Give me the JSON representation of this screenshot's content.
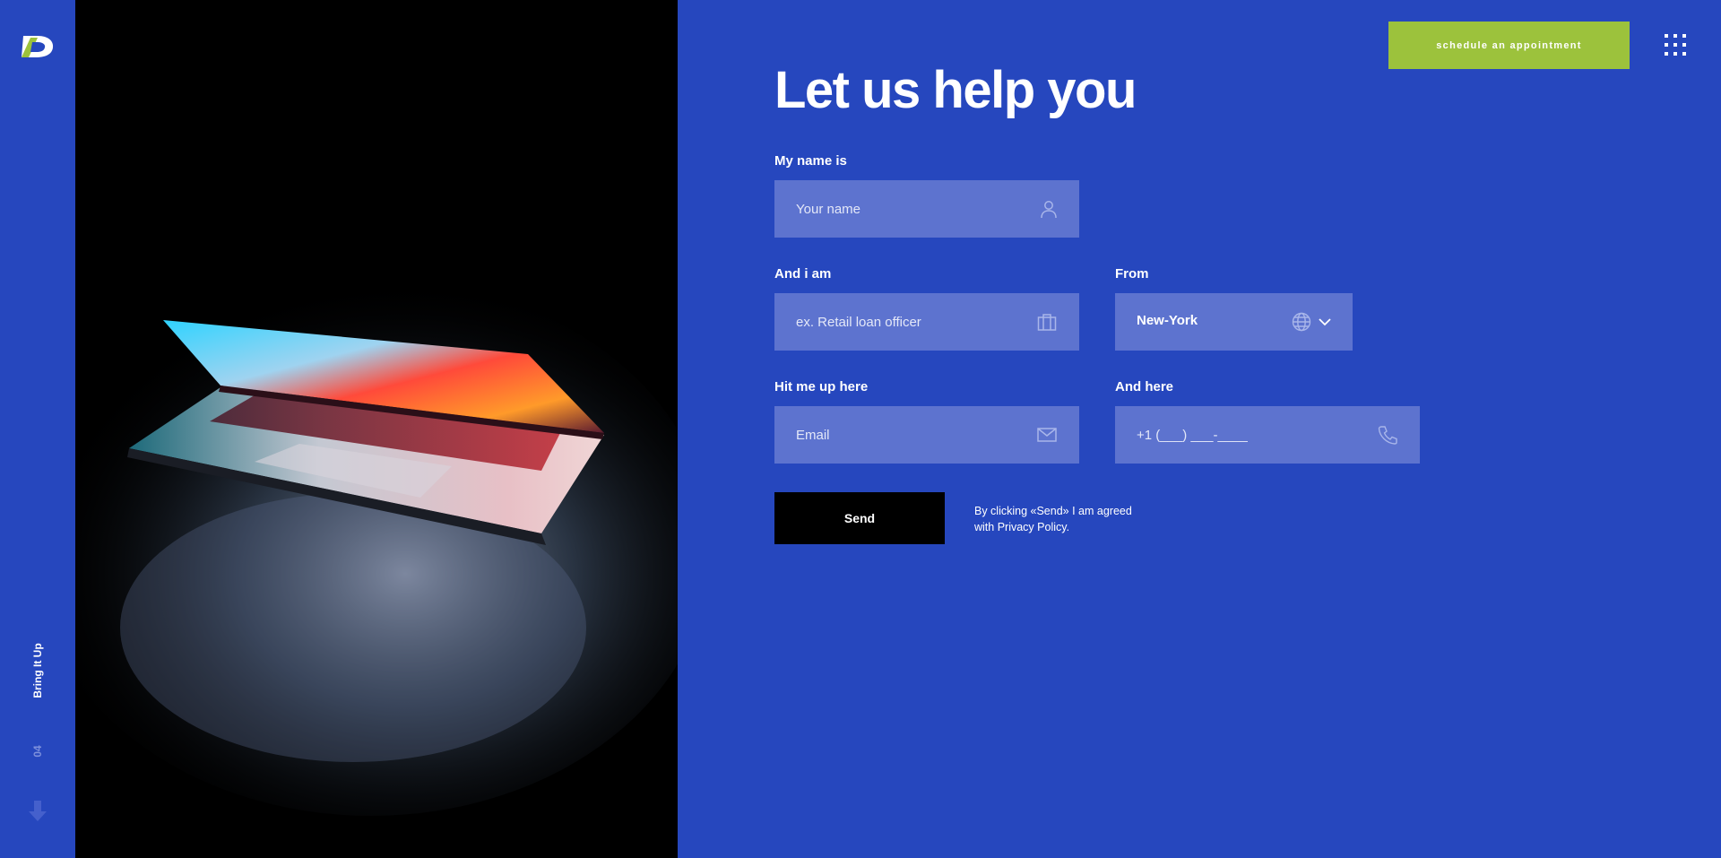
{
  "sidebar": {
    "logo_name": "brand-logo",
    "vertical_label": "Bring It Up",
    "page_number": "04",
    "icons": {
      "down": "down-arrow-icon"
    }
  },
  "header": {
    "cta_label": "schedule an appointment",
    "menu_icon": "grid-menu-icon"
  },
  "form": {
    "title": "Let us help you",
    "name": {
      "label": "My name is",
      "placeholder": "Your name",
      "icon": "user-icon"
    },
    "role": {
      "label": "And i am",
      "placeholder": "ex. Retail loan officer",
      "icon": "briefcase-icon"
    },
    "location": {
      "label": "From",
      "value": "New-York",
      "icon": "globe-icon",
      "chevron": "chevron-down-icon"
    },
    "email": {
      "label": "Hit me up here",
      "placeholder": "Email",
      "icon": "mail-icon"
    },
    "phone": {
      "label": "And here",
      "placeholder": "+1 (___) ___-____",
      "icon": "phone-icon"
    },
    "send_label": "Send",
    "consent_line1": "By clicking «Send» I am agreed",
    "consent_line2": "with Privacy Policy."
  },
  "colors": {
    "background": "#2647be",
    "field": "#5d73cf",
    "accent": "#9cc23c",
    "button": "#000000"
  }
}
